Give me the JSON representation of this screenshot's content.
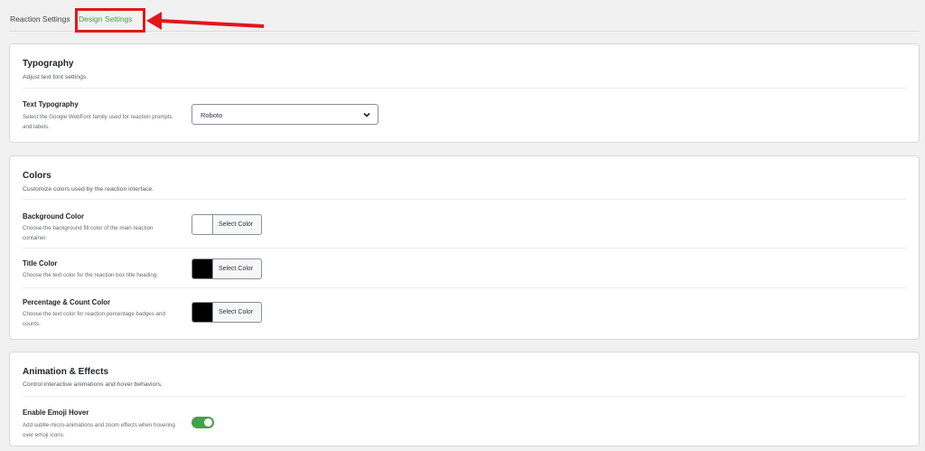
{
  "tabs": [
    {
      "label": "Reaction Settings",
      "active": false
    },
    {
      "label": "Design Settings",
      "active": true
    }
  ],
  "colors": {
    "accent": "#46a149",
    "highlight": "#e3161c"
  },
  "typography": {
    "title": "Typography",
    "description": "Adjust text font settings.",
    "text_typography": {
      "label": "Text Typography",
      "description": "Select the Google WebFont family used for reaction prompts and labels.",
      "value": "Roboto"
    }
  },
  "colors_section": {
    "title": "Colors",
    "description": "Customize colors used by the reaction interface.",
    "items": [
      {
        "label": "Background Color",
        "description": "Choose the background fill color of the main reaction container.",
        "button": "Select Color",
        "swatch": "#ffffff"
      },
      {
        "label": "Title Color",
        "description": "Choose the text color for the reaction box title heading.",
        "button": "Select Color",
        "swatch": "#000000"
      },
      {
        "label": "Percentage & Count Color",
        "description": "Choose the text color for reaction percentage badges and counts.",
        "button": "Select Color",
        "swatch": "#000000"
      }
    ]
  },
  "animation": {
    "title": "Animation & Effects",
    "description": "Control interactive animations and hover behaviors.",
    "emoji_hover": {
      "label": "Enable Emoji Hover",
      "description": "Add subtle micro-animations and zoom effects when hovering over emoji icons.",
      "enabled": true
    }
  }
}
